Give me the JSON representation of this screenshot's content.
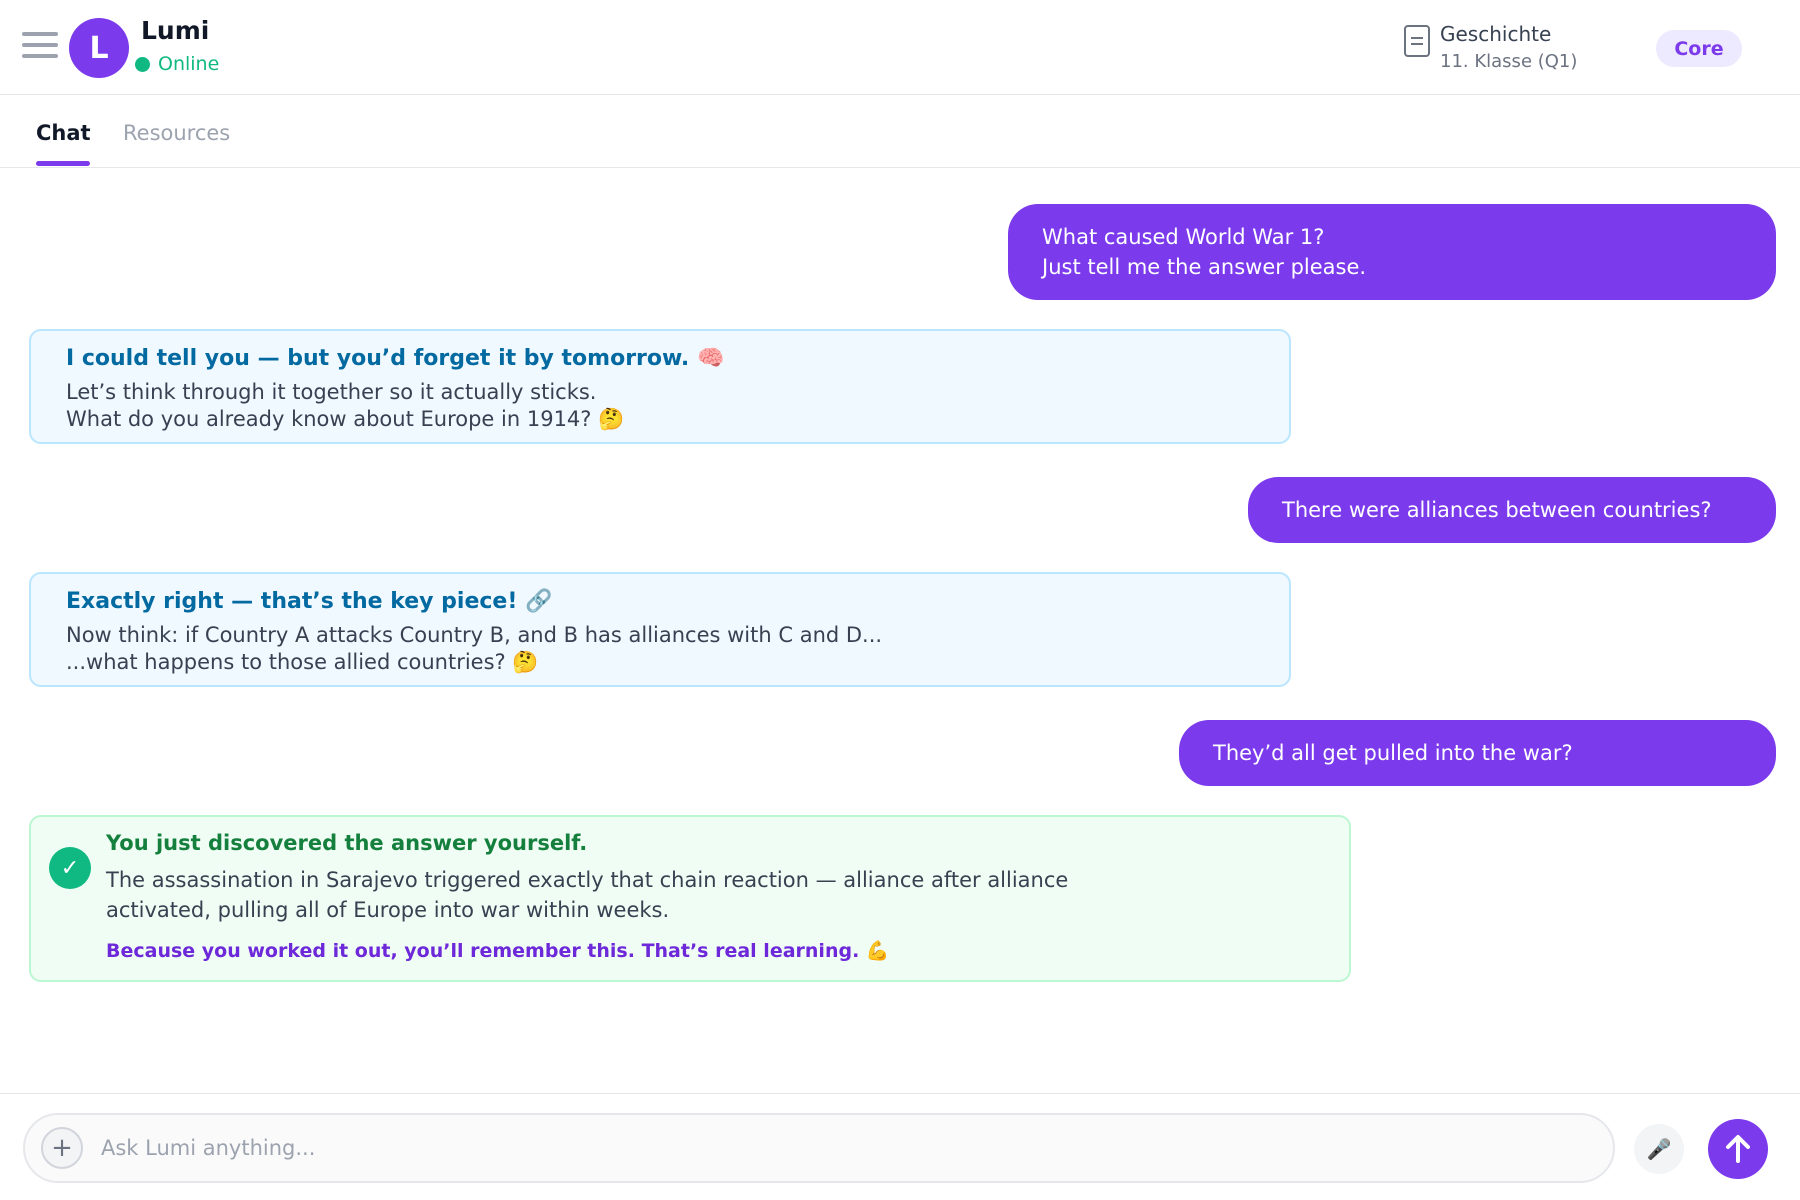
{
  "header": {
    "avatar_letter": "L",
    "bot_name": "Lumi",
    "status": "Online",
    "subject": "Geschichte",
    "grade": "11. Klasse (Q1)",
    "badge": "Core",
    "icons": {
      "menu": "hamburger-menu-icon",
      "subject": "document-icon"
    }
  },
  "tabs": [
    {
      "label": "Chat",
      "active": true
    },
    {
      "label": "Resources",
      "active": false
    }
  ],
  "messages": [
    {
      "role": "user",
      "lines": [
        "What caused World War 1?",
        "Just tell me the answer please."
      ]
    },
    {
      "role": "bot",
      "title": "I could tell you — but you’d forget it by tomorrow. 🧠",
      "lines": [
        "Let’s think through it together so it actually sticks.",
        "What do you already know about Europe in 1914? 🤔"
      ]
    },
    {
      "role": "user",
      "lines": [
        "There were alliances between countries?"
      ]
    },
    {
      "role": "bot",
      "title": "Exactly right — that’s the key piece! 🔗",
      "lines": [
        "Now think: if Country A attacks Country B, and B has alliances with C and D...",
        "...what happens to those allied countries? 🤔"
      ]
    },
    {
      "role": "user",
      "lines": [
        "They’d all get pulled into the war?"
      ]
    },
    {
      "role": "bot-success",
      "title": "You just discovered the answer yourself.",
      "body": "The assassination in Sarajevo triggered exactly that chain reaction — alliance after alliance activated, pulling all of Europe into war within weeks.",
      "footer": "Because you worked it out, you’ll remember this. That’s real learning. 💪"
    }
  ],
  "composer": {
    "placeholder": "Ask Lumi anything...",
    "plus_label": "+",
    "mic_label": "🎤"
  },
  "colors": {
    "accent": "#7c3aed",
    "online": "#10b981",
    "bot_title": "#0369a1",
    "success_title": "#15803d"
  }
}
